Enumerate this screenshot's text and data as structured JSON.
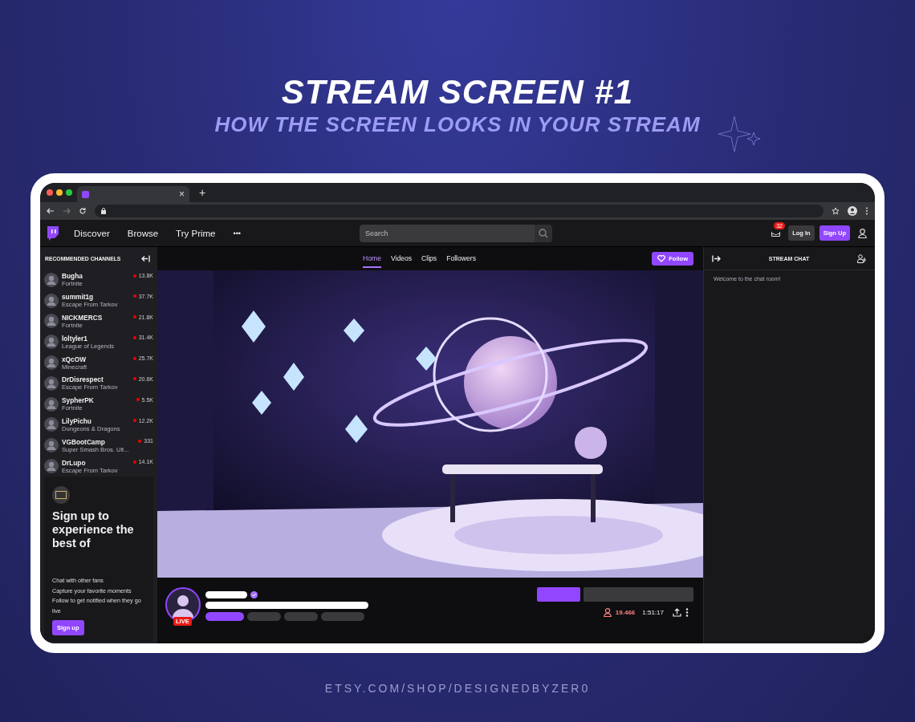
{
  "title": "STREAM SCREEN #1",
  "subtitle": "HOW THE SCREEN LOOKS IN YOUR STREAM",
  "browser": {
    "tab_close": "×",
    "new_tab": "+"
  },
  "nav": {
    "items": [
      "Discover",
      "Browse",
      "Try Prime"
    ],
    "more": "•••",
    "search": {
      "placeholder": "Search"
    },
    "notifications": "32",
    "login": "Log In",
    "signup": "Sign Up"
  },
  "sidebar": {
    "heading": "RECOMMENDED CHANNELS",
    "channels": [
      {
        "name": "Bugha",
        "game": "Fortnite",
        "viewers": "13.8K"
      },
      {
        "name": "summit1g",
        "game": "Escape From Tarkov",
        "viewers": "37.7K"
      },
      {
        "name": "NICKMERCS",
        "game": "Fortnite",
        "viewers": "21.8K"
      },
      {
        "name": "loltyler1",
        "game": "League of Legends",
        "viewers": "31.4K"
      },
      {
        "name": "xQcOW",
        "game": "Minecraft",
        "viewers": "25.7K"
      },
      {
        "name": "DrDisrespect",
        "game": "Escape From Tarkov",
        "viewers": "20.6K"
      },
      {
        "name": "SypherPK",
        "game": "Fortnite",
        "viewers": "5.5K"
      },
      {
        "name": "LilyPichu",
        "game": "Dungeons & Dragons",
        "viewers": "12.2K"
      },
      {
        "name": "VGBootCamp",
        "game": "Super Smash Bros. Ult...",
        "viewers": "331"
      },
      {
        "name": "DrLupo",
        "game": "Escape From Tarkov",
        "viewers": "14.1K"
      }
    ],
    "promo": {
      "title": "Sign up to experience the best of",
      "bullets": [
        "Chat with other fans",
        "Capture your favorite moments",
        "Follow to get notified when they go live"
      ],
      "button": "Sign up"
    }
  },
  "channel_tabs": [
    {
      "label": "Home",
      "selected": true
    },
    {
      "label": "Videos",
      "selected": false
    },
    {
      "label": "Clips",
      "selected": false
    },
    {
      "label": "Followers",
      "selected": false
    }
  ],
  "follow": "Follow",
  "stream": {
    "live": "LIVE",
    "viewers": "19.466",
    "uptime": "1:51:17"
  },
  "chat": {
    "title": "STREAM CHAT",
    "welcome": "Welcome to the chat room!"
  },
  "footer": "ETSY.COM/SHOP/DESIGNEDBYZER0"
}
